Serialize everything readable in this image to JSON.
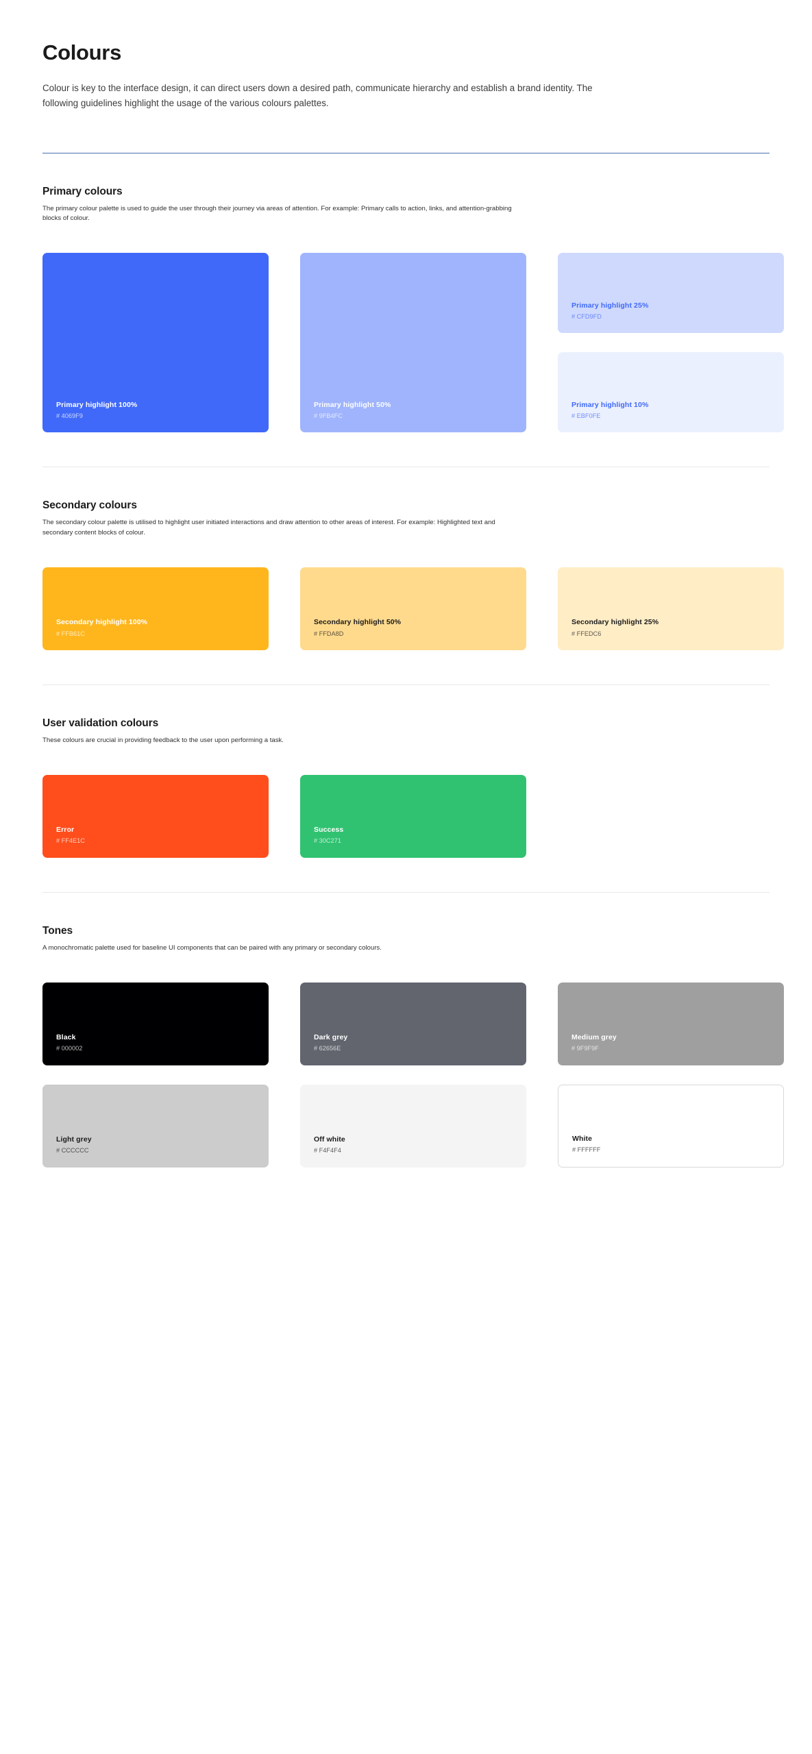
{
  "page": {
    "title": "Colours",
    "intro": "Colour is key to the interface design, it can direct users down a desired path, communicate hierarchy and establish a brand identity. The following guidelines highlight the usage of the various colours palettes.",
    "rule_color": "#4A6FB0"
  },
  "sections": [
    {
      "id": "primary",
      "title": "Primary colours",
      "description": "The primary colour palette is used to guide the user through their journey via areas of attention. For example: Primary calls to action, links, and attention-grabbing blocks of colour.",
      "swatches": [
        {
          "name": "Primary highlight 100%",
          "hex": "# 4069F9",
          "bg": "#4069F9",
          "text": "#FFFFFF"
        },
        {
          "name": "Primary highlight 50%",
          "hex": "# 9FB4FC",
          "bg": "#9FB4FC",
          "text": "#FFFFFF"
        },
        {
          "name": "Primary highlight 25%",
          "hex": "# CFD9FD",
          "bg": "#CFD9FD",
          "text": "#4069F9"
        },
        {
          "name": "Primary highlight 10%",
          "hex": "# EBF0FE",
          "bg": "#EBF0FE",
          "text": "#4069F9"
        }
      ]
    },
    {
      "id": "secondary",
      "title": "Secondary colours",
      "description": "The secondary colour palette is utilised to highlight user initiated interactions and draw attention to other areas of interest. For example: Highlighted text and secondary content blocks of colour.",
      "swatches": [
        {
          "name": "Secondary highlight 100%",
          "hex": "# FFB61C",
          "bg": "#FFB61C",
          "text": "#FFFFFF"
        },
        {
          "name": "Secondary highlight 50%",
          "hex": "# FFDA8D",
          "bg": "#FFDA8D",
          "text": "#1B1B1B"
        },
        {
          "name": "Secondary highlight 25%",
          "hex": "# FFEDC6",
          "bg": "#FFEDC6",
          "text": "#1B1B1B"
        }
      ]
    },
    {
      "id": "validation",
      "title": "User validation colours",
      "description": "These colours are crucial in providing feedback to the user upon performing a task.",
      "swatches": [
        {
          "name": "Error",
          "hex": "# FF4E1C",
          "bg": "#FF4E1C",
          "text": "#FFFFFF"
        },
        {
          "name": "Success",
          "hex": "# 30C271",
          "bg": "#30C271",
          "text": "#FFFFFF"
        }
      ]
    },
    {
      "id": "tones",
      "title": "Tones",
      "description": "A monochromatic palette used for baseline UI components that can be paired with any primary or secondary colours.",
      "swatches": [
        {
          "name": "Black",
          "hex": "# 000002",
          "bg": "#000002",
          "text": "#FFFFFF"
        },
        {
          "name": "Dark grey",
          "hex": "# 62656E",
          "bg": "#62656E",
          "text": "#FFFFFF"
        },
        {
          "name": "Medium grey",
          "hex": "# 9F9F9F",
          "bg": "#9F9F9F",
          "text": "#FFFFFF"
        },
        {
          "name": "Light grey",
          "hex": "# CCCCCC",
          "bg": "#CCCCCC",
          "text": "#1B1B1B"
        },
        {
          "name": "Off white",
          "hex": "# F4F4F4",
          "bg": "#F4F4F4",
          "text": "#1B1B1B"
        },
        {
          "name": "White",
          "hex": "# FFFFFF",
          "bg": "#FFFFFF",
          "text": "#1B1B1B",
          "outlined": true
        }
      ]
    }
  ]
}
